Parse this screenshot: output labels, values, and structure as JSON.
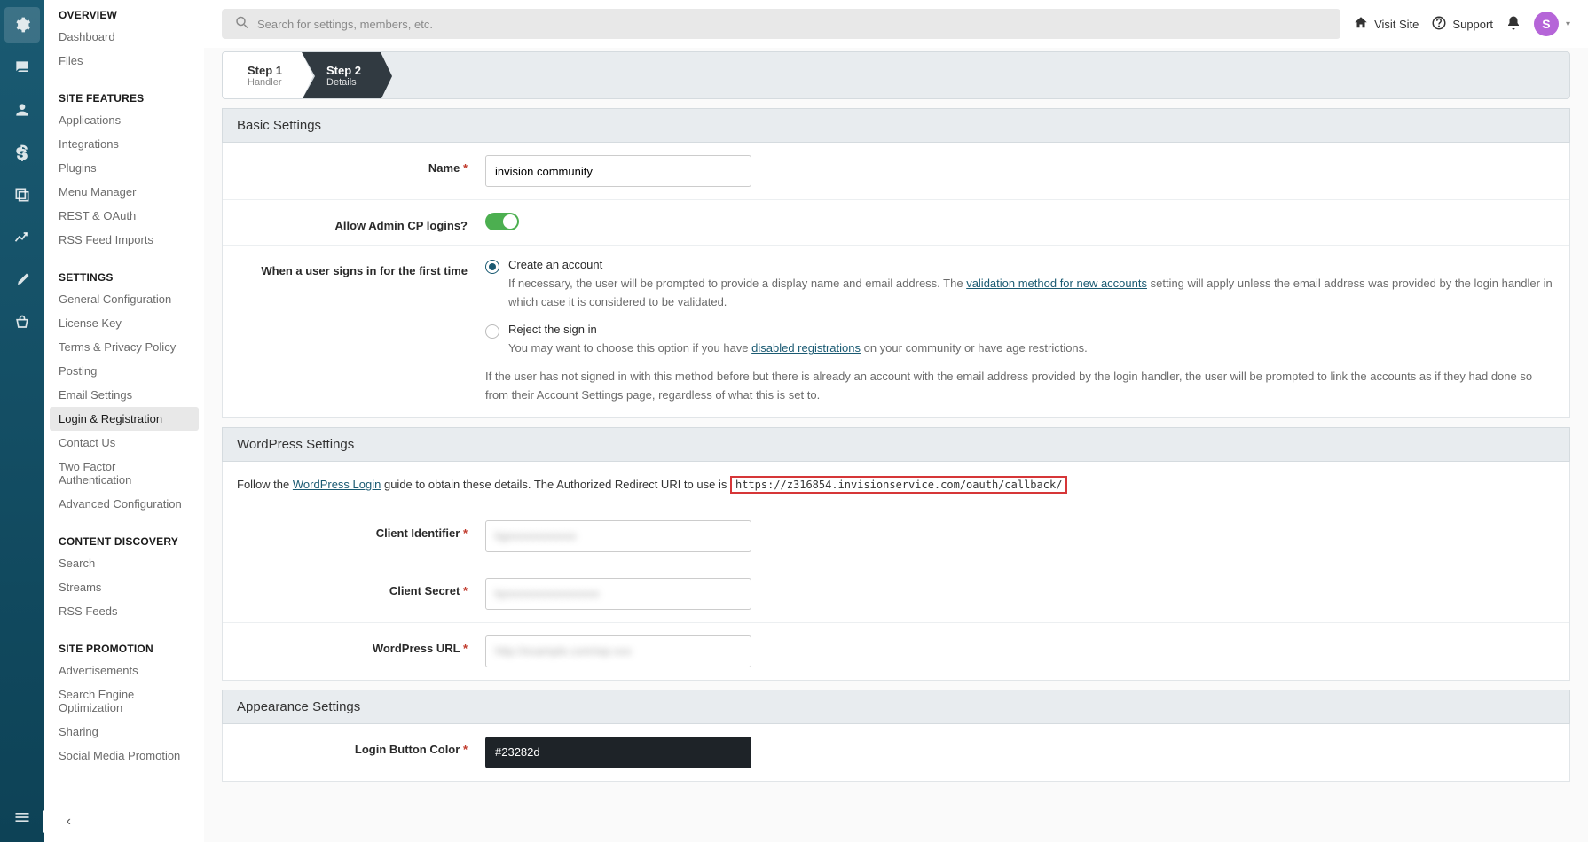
{
  "topbar": {
    "search_placeholder": "Search for settings, members, etc.",
    "visit_site": "Visit Site",
    "support": "Support",
    "avatar_letter": "S"
  },
  "steps": {
    "step1_title": "Step 1",
    "step1_sub": "Handler",
    "step2_title": "Step 2",
    "step2_sub": "Details"
  },
  "sidebar": {
    "overview": {
      "title": "OVERVIEW",
      "items": [
        "Dashboard",
        "Files"
      ]
    },
    "site_features": {
      "title": "SITE FEATURES",
      "items": [
        "Applications",
        "Integrations",
        "Plugins",
        "Menu Manager",
        "REST & OAuth",
        "RSS Feed Imports"
      ]
    },
    "settings": {
      "title": "SETTINGS",
      "items": [
        "General Configuration",
        "License Key",
        "Terms & Privacy Policy",
        "Posting",
        "Email Settings",
        "Login & Registration",
        "Contact Us",
        "Two Factor Authentication",
        "Advanced Configuration"
      ],
      "active": "Login & Registration"
    },
    "content_discovery": {
      "title": "CONTENT DISCOVERY",
      "items": [
        "Search",
        "Streams",
        "RSS Feeds"
      ]
    },
    "site_promotion": {
      "title": "SITE PROMOTION",
      "items": [
        "Advertisements",
        "Search Engine Optimization",
        "Sharing",
        "Social Media Promotion"
      ]
    }
  },
  "sections": {
    "basic": "Basic Settings",
    "wordpress": "WordPress Settings",
    "appearance": "Appearance Settings"
  },
  "fields": {
    "name_label": "Name",
    "name_value": "invision community",
    "allow_admin_label": "Allow Admin CP logins?",
    "first_signin_label": "When a user signs in for the first time",
    "opt_create_title": "Create an account",
    "opt_create_desc_pre": "If necessary, the user will be prompted to provide a display name and email address. The ",
    "opt_create_link": "validation method for new accounts",
    "opt_create_desc_post": " setting will apply unless the email address was provided by the login handler in which case it is considered to be validated.",
    "opt_reject_title": "Reject the sign in",
    "opt_reject_desc_pre": "You may want to choose this option if you have ",
    "opt_reject_link": "disabled registrations",
    "opt_reject_desc_post": " on your community or have age restrictions.",
    "signin_note": "If the user has not signed in with this method before but there is already an account with the email address provided by the login handler, the user will be prompted to link the accounts as if they had done so from their Account Settings page, regardless of what this is set to.",
    "wp_inst_pre": "Follow the ",
    "wp_inst_link": "WordPress Login",
    "wp_inst_mid": " guide to obtain these details. The Authorized Redirect URI to use is ",
    "wp_inst_code": "https://z316854.invisionservice.com/oauth/callback/",
    "client_id_label": "Client Identifier",
    "client_secret_label": "Client Secret",
    "wp_url_label": "WordPress URL",
    "login_color_label": "Login Button Color",
    "login_color_value": "#23282d",
    "blurred_id": "kgxxxxxxxxxxxx",
    "blurred_secret": "kpxxxxxxxxxxxxxxxx",
    "blurred_url": "http://example.com/wp-xxx"
  }
}
